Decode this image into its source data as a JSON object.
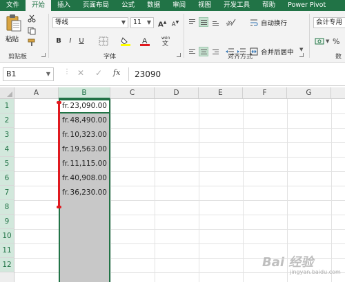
{
  "ribbon": {
    "tabs": [
      "文件",
      "开始",
      "插入",
      "页面布局",
      "公式",
      "数据",
      "审阅",
      "视图",
      "开发工具",
      "帮助",
      "Power Pivot"
    ],
    "active_tab": "开始",
    "clipboard": {
      "paste_label": "粘贴",
      "group_label": "剪贴板"
    },
    "font": {
      "name": "等线",
      "size": "11",
      "group_label": "字体",
      "bold": "B",
      "italic": "I",
      "underline": "U",
      "grow": "A",
      "shrink": "A"
    },
    "alignment": {
      "wrap_text": "自动换行",
      "merge_center": "合并后居中",
      "group_label": "对齐方式"
    },
    "number": {
      "format": "会计专用",
      "group_label": "数"
    },
    "accent_color": "#217346"
  },
  "formula_bar": {
    "name_box": "B1",
    "fx_label": "fx",
    "value": "23090"
  },
  "sheet": {
    "columns": [
      "A",
      "B",
      "C",
      "D",
      "E",
      "F",
      "G"
    ],
    "selected_column": "B",
    "rows": [
      "1",
      "2",
      "3",
      "4",
      "5",
      "6",
      "7",
      "8",
      "9",
      "10",
      "11",
      "12"
    ],
    "currency_prefix": "fr.",
    "b_values": [
      "23,090.00",
      "48,490.00",
      "10,323.00",
      "19,563.00",
      "11,115.00",
      "40,908.00",
      "36,230.00"
    ],
    "annotation_color": "#e0191f"
  },
  "watermark": {
    "text": "Bai 经验",
    "subtext": "jingyan.baidu.com"
  }
}
